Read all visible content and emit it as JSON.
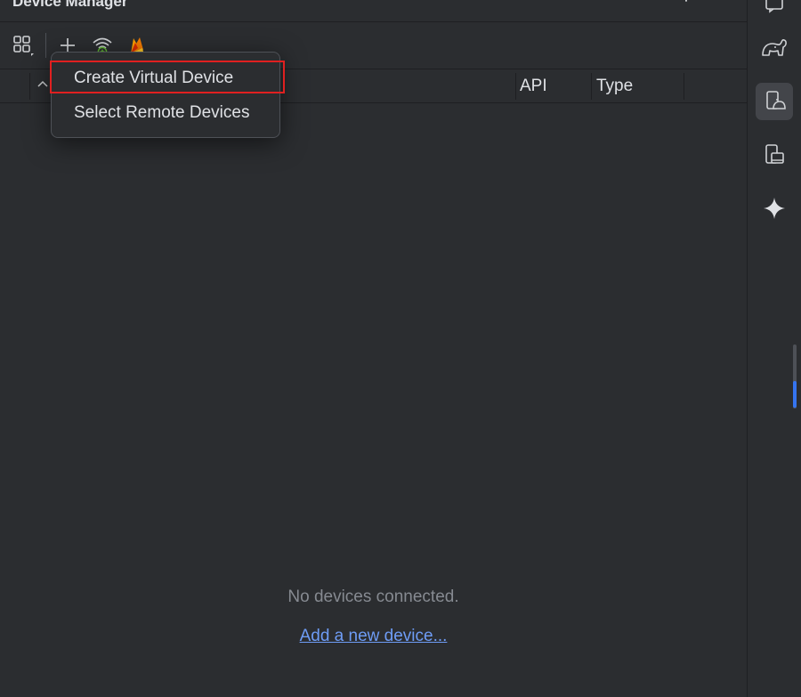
{
  "window": {
    "title": "Device Manager",
    "more_glyph": "⋮"
  },
  "toolbar": {
    "buttons": [
      {
        "name": "device-grid-icon"
      },
      {
        "name": "add-icon"
      },
      {
        "name": "wifi-pair-icon"
      },
      {
        "name": "firebase-icon"
      }
    ]
  },
  "table": {
    "columns": [
      "API",
      "Type"
    ],
    "sort_indicator": "chevron-up-icon"
  },
  "menu": {
    "items": [
      {
        "label": "Create Virtual Device",
        "highlighted": true
      },
      {
        "label": "Select Remote Devices"
      }
    ]
  },
  "empty_state": {
    "message": "No devices connected.",
    "link": "Add a new device..."
  },
  "right_toolbar": {
    "icons": [
      "notifications-icon",
      "gradle-elephant-icon",
      "device-manager-icon",
      "running-devices-icon",
      "gemini-sparkle-icon"
    ],
    "active": "device-manager-icon"
  },
  "colors": {
    "background": "#2b2d30",
    "accent": "#3574f0",
    "link": "#6e9cf5",
    "highlight": "#e02020"
  }
}
